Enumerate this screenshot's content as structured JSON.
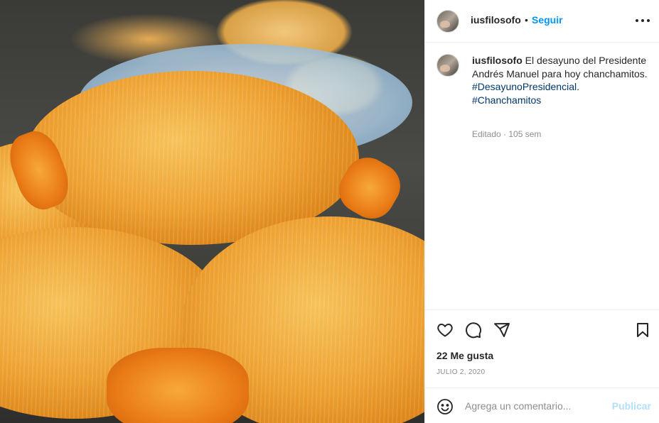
{
  "post": {
    "username": "iusfilosofo",
    "separator": "•",
    "follow_label": "Seguir",
    "more_icon": "more-options-icon",
    "caption": {
      "username": "iusfilosofo",
      "text": "El desayuno del Presidente Andrés Manuel para hoy chanchamitos.",
      "hashtags": [
        "#DesayunoPresidencial.",
        "#Chanchamitos"
      ],
      "meta": "Editado · 105 sem"
    },
    "actions": {
      "like_icon": "heart-icon",
      "comment_icon": "comment-icon",
      "share_icon": "send-icon",
      "save_icon": "bookmark-icon"
    },
    "likes_label": "22 Me gusta",
    "date": "JULIO 2, 2020",
    "comment_box": {
      "emoji_icon": "emoji-icon",
      "placeholder": "Agrega un comentario...",
      "publish_label": "Publicar"
    }
  },
  "colors": {
    "accent": "#0095f6",
    "hashtag": "#00376b",
    "muted": "#8e8e8e",
    "publish_disabled": "#b2dffc"
  }
}
